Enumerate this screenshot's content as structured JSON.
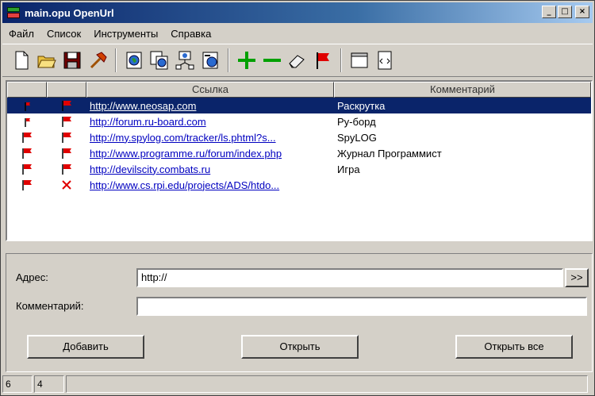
{
  "window": {
    "title": "main.opu  OpenUrl",
    "minimize": "_",
    "maximize": "□",
    "close": "×"
  },
  "menu": [
    "Файл",
    "Список",
    "Инструменты",
    "Справка"
  ],
  "toolbar": [
    "new-document-icon",
    "open-folder-icon",
    "save-disk-icon",
    "hammer-icon",
    "globe-icon",
    "globe-copy-icon",
    "globe-network-icon",
    "globe-page-icon",
    "add-plus-icon",
    "remove-minus-icon",
    "eraser-icon",
    "red-flag-icon",
    "window-frame-icon",
    "page-code-icon"
  ],
  "table": {
    "headers": [
      "",
      "",
      "Ссылка",
      "Комментарий"
    ],
    "rows": [
      {
        "flag1": "flag-small",
        "flag2": "flag",
        "url": "http://www.neosap.com",
        "comment": "Раскрутка",
        "selected": true
      },
      {
        "flag1": "flag-small",
        "flag2": "flag",
        "url": "http://forum.ru-board.com",
        "comment": "Ру-борд",
        "selected": false
      },
      {
        "flag1": "flag",
        "flag2": "flag",
        "url": "http://my.spylog.com/tracker/ls.phtml?s...",
        "comment": "SpyLOG",
        "selected": false
      },
      {
        "flag1": "flag",
        "flag2": "flag",
        "url": "http://www.programme.ru/forum/index.php",
        "comment": "Журнал Программист",
        "selected": false
      },
      {
        "flag1": "flag",
        "flag2": "flag",
        "url": "http://devilscity.combats.ru",
        "comment": "Игра",
        "selected": false
      },
      {
        "flag1": "flag",
        "flag2": "cross",
        "url": "http://www.cs.rpi.edu/projects/ADS/htdo...",
        "comment": "",
        "selected": false
      }
    ]
  },
  "form": {
    "address_label": "Адрес:",
    "address_value": "http://",
    "go_label": ">>",
    "comment_label": "Комментарий:",
    "comment_value": "",
    "add_label": "Добавить",
    "open_label": "Открыть",
    "open_all_label": "Открыть все"
  },
  "status": {
    "count": "6",
    "selected": "4",
    "message": ""
  },
  "colors": {
    "selection": "#0a246a",
    "link": "#0000c0",
    "flag": "#e00000",
    "plus": "#00a000"
  }
}
